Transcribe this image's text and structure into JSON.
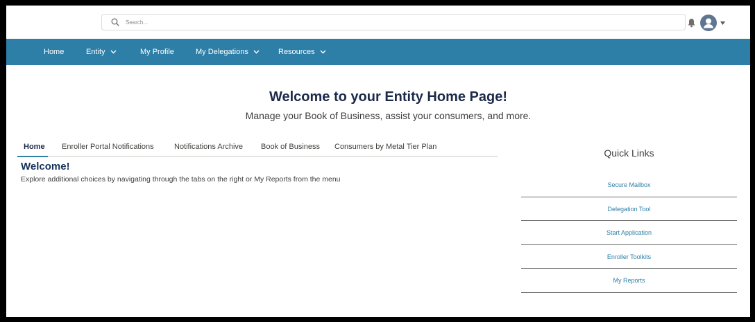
{
  "header": {
    "search_placeholder": "Search...",
    "icons": [
      "search-icon",
      "bell-icon",
      "user-avatar-icon",
      "caret-down-icon"
    ]
  },
  "nav": {
    "items": [
      {
        "label": "Home",
        "has_dropdown": false
      },
      {
        "label": "Entity",
        "has_dropdown": true
      },
      {
        "label": "My Profile",
        "has_dropdown": false
      },
      {
        "label": "My Delegations",
        "has_dropdown": true
      },
      {
        "label": "Resources",
        "has_dropdown": true
      }
    ],
    "color": "#2d7fa8"
  },
  "hero": {
    "title": "Welcome to your Entity Home Page!",
    "subtitle": "Manage your Book of Business, assist your consumers, and more."
  },
  "tabs": [
    {
      "label": "Home",
      "active": true
    },
    {
      "label": "Enroller Portal Notifications",
      "active": false
    },
    {
      "label": "Notifications Archive",
      "active": false
    },
    {
      "label": "Book of Business",
      "active": false
    },
    {
      "label": "Consumers by Metal Tier Plan",
      "active": false
    }
  ],
  "content": {
    "heading": "Welcome!",
    "text": "Explore additional choices by navigating through the tabs on the right or My Reports from the menu"
  },
  "quick_links": {
    "title": "Quick Links",
    "items": [
      {
        "label": "Secure Mailbox"
      },
      {
        "label": "Delegation Tool"
      },
      {
        "label": "Start Application"
      },
      {
        "label": "Enroller Toolkits"
      },
      {
        "label": "My Reports"
      }
    ]
  }
}
